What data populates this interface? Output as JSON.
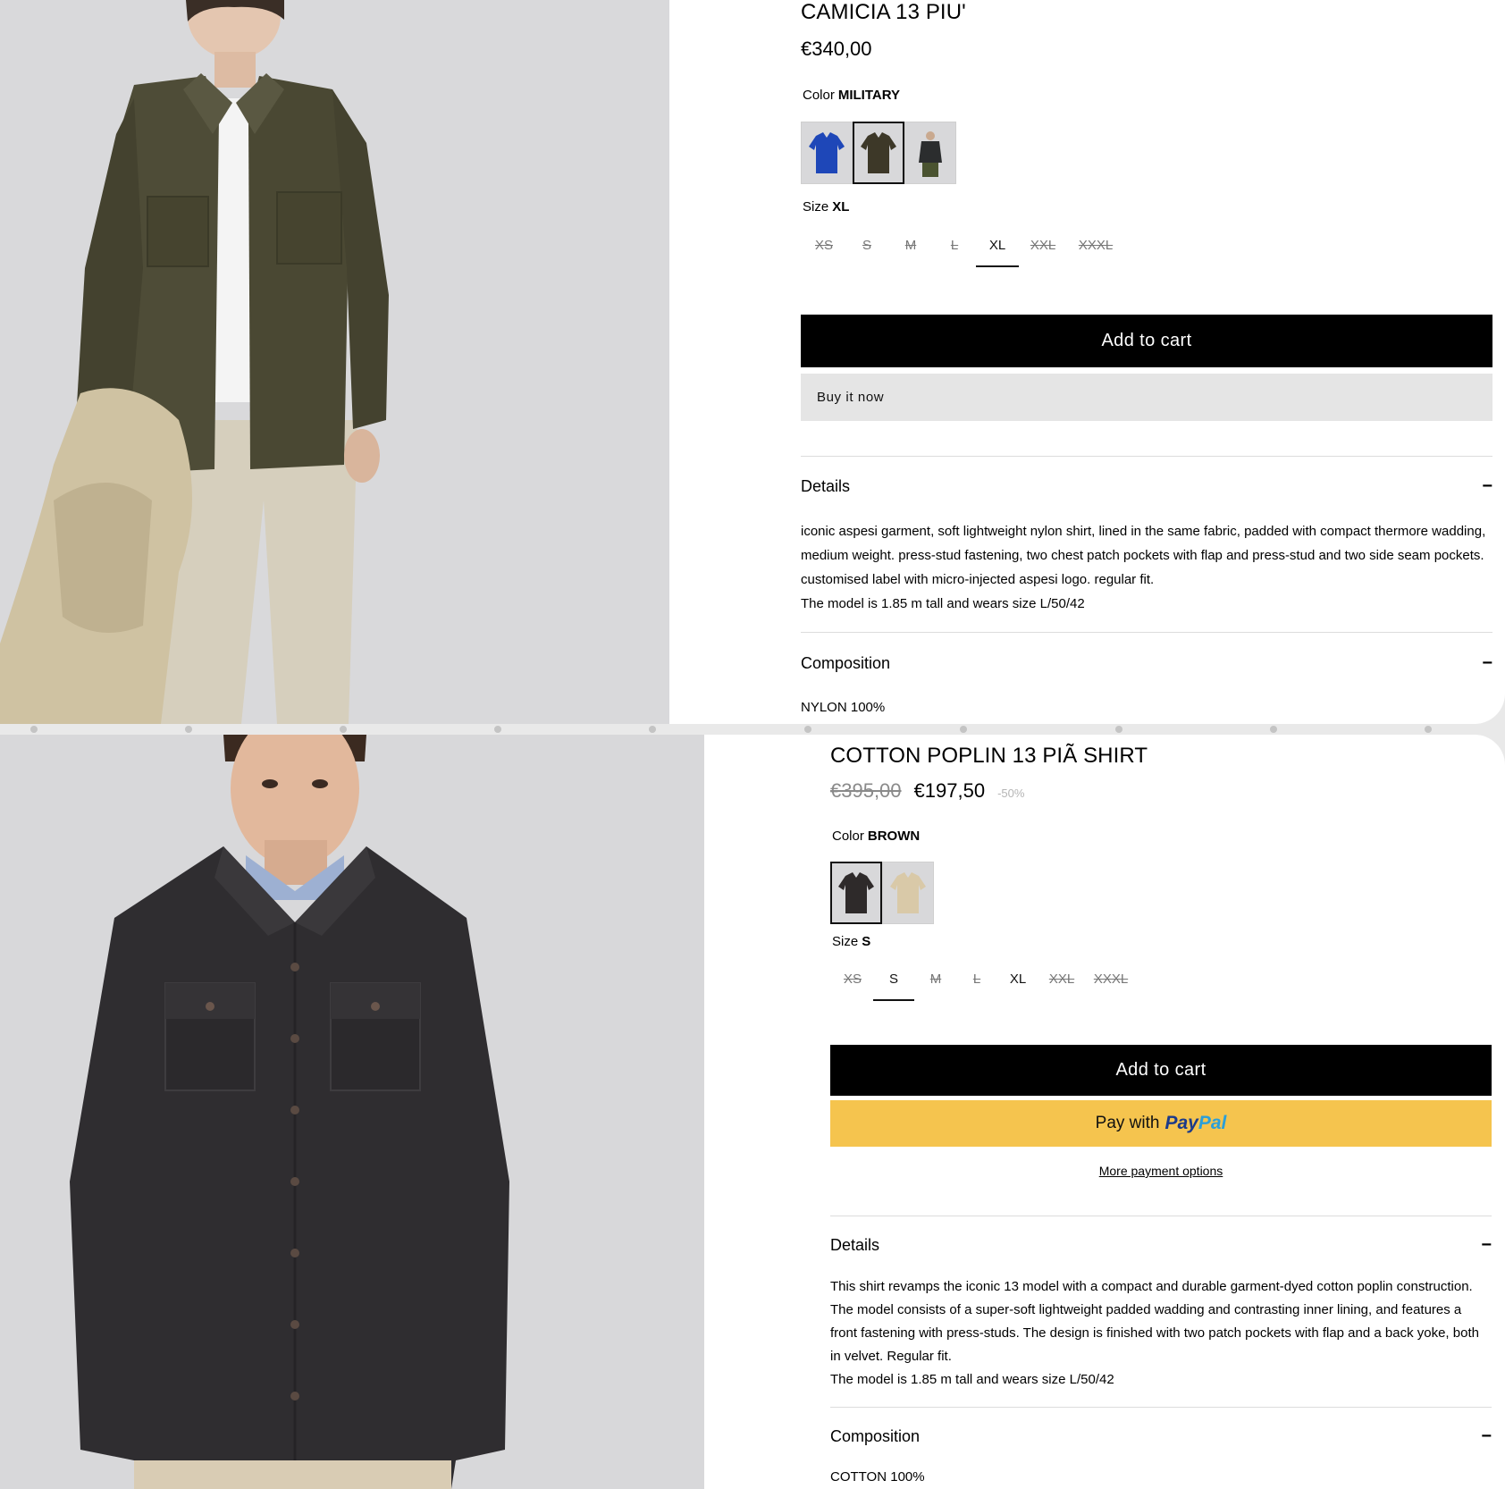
{
  "product1": {
    "title": "CAMICIA 13 PIU'",
    "price": "€340,00",
    "color_label": "Color",
    "color_value": "MILITARY",
    "swatches": [
      {
        "name": "blue",
        "color": "#1e47b8"
      },
      {
        "name": "military",
        "color": "#3d3828",
        "selected": true
      },
      {
        "name": "black",
        "color": "#2b2d2e"
      }
    ],
    "size_label": "Size",
    "size_value": "XL",
    "sizes": [
      {
        "label": "XS",
        "available": false
      },
      {
        "label": "S",
        "available": false
      },
      {
        "label": "M",
        "available": false
      },
      {
        "label": "L",
        "available": false
      },
      {
        "label": "XL",
        "available": true,
        "selected": true
      },
      {
        "label": "XXL",
        "available": false
      },
      {
        "label": "XXXL",
        "available": false
      }
    ],
    "add_to_cart": "Add to cart",
    "buy_now": "Buy it now",
    "details_heading": "Details",
    "details_toggle": "−",
    "details_text": "iconic aspesi garment, soft lightweight nylon shirt, lined in the same fabric, padded with compact thermore wadding, medium weight. press-stud fastening, two chest patch pockets with flap and press-stud and two side seam pockets. customised label with micro-injected aspesi logo. regular fit.",
    "model_info": "The model is 1.85 m tall and wears size L/50/42",
    "composition_heading": "Composition",
    "composition_toggle": "−",
    "composition_text": "NYLON 100%"
  },
  "product2": {
    "title": "COTTON POPLIN 13 PIÃ     SHIRT",
    "price_old": "€395,00",
    "price": "€197,50",
    "discount": "-50%",
    "color_label": "Color",
    "color_value": "BROWN",
    "swatches": [
      {
        "name": "brown",
        "color": "#2e2a2a",
        "selected": true
      },
      {
        "name": "beige",
        "color": "#d9c9a8"
      }
    ],
    "size_label": "Size",
    "size_value": "S",
    "sizes": [
      {
        "label": "XS",
        "available": false
      },
      {
        "label": "S",
        "available": true,
        "selected": true
      },
      {
        "label": "M",
        "available": false
      },
      {
        "label": "L",
        "available": false
      },
      {
        "label": "XL",
        "available": true
      },
      {
        "label": "XXL",
        "available": false
      },
      {
        "label": "XXXL",
        "available": false
      }
    ],
    "add_to_cart": "Add to cart",
    "paypal_prefix": "Pay with",
    "paypal_brand_1": "Pay",
    "paypal_brand_2": "Pal",
    "more_payment": "More payment options",
    "details_heading": "Details",
    "details_toggle": "−",
    "details_text": "This shirt revamps the iconic 13 model with a compact and durable garment-dyed cotton poplin construction. The model consists of a super-soft lightweight padded wadding and contrasting inner lining, and features a front fastening with press-studs. The design is finished with two patch pockets with flap and a back yoke, both in velvet. Regular fit.",
    "model_info": "The model is 1.85 m tall and wears size L/50/42",
    "composition_heading": "Composition",
    "composition_toggle": "−",
    "composition_text": "COTTON 100%"
  },
  "colors": {
    "accent_black": "#000000",
    "paypal_yellow": "#f5c44e",
    "buy_now_gray": "#e5e5e5"
  }
}
